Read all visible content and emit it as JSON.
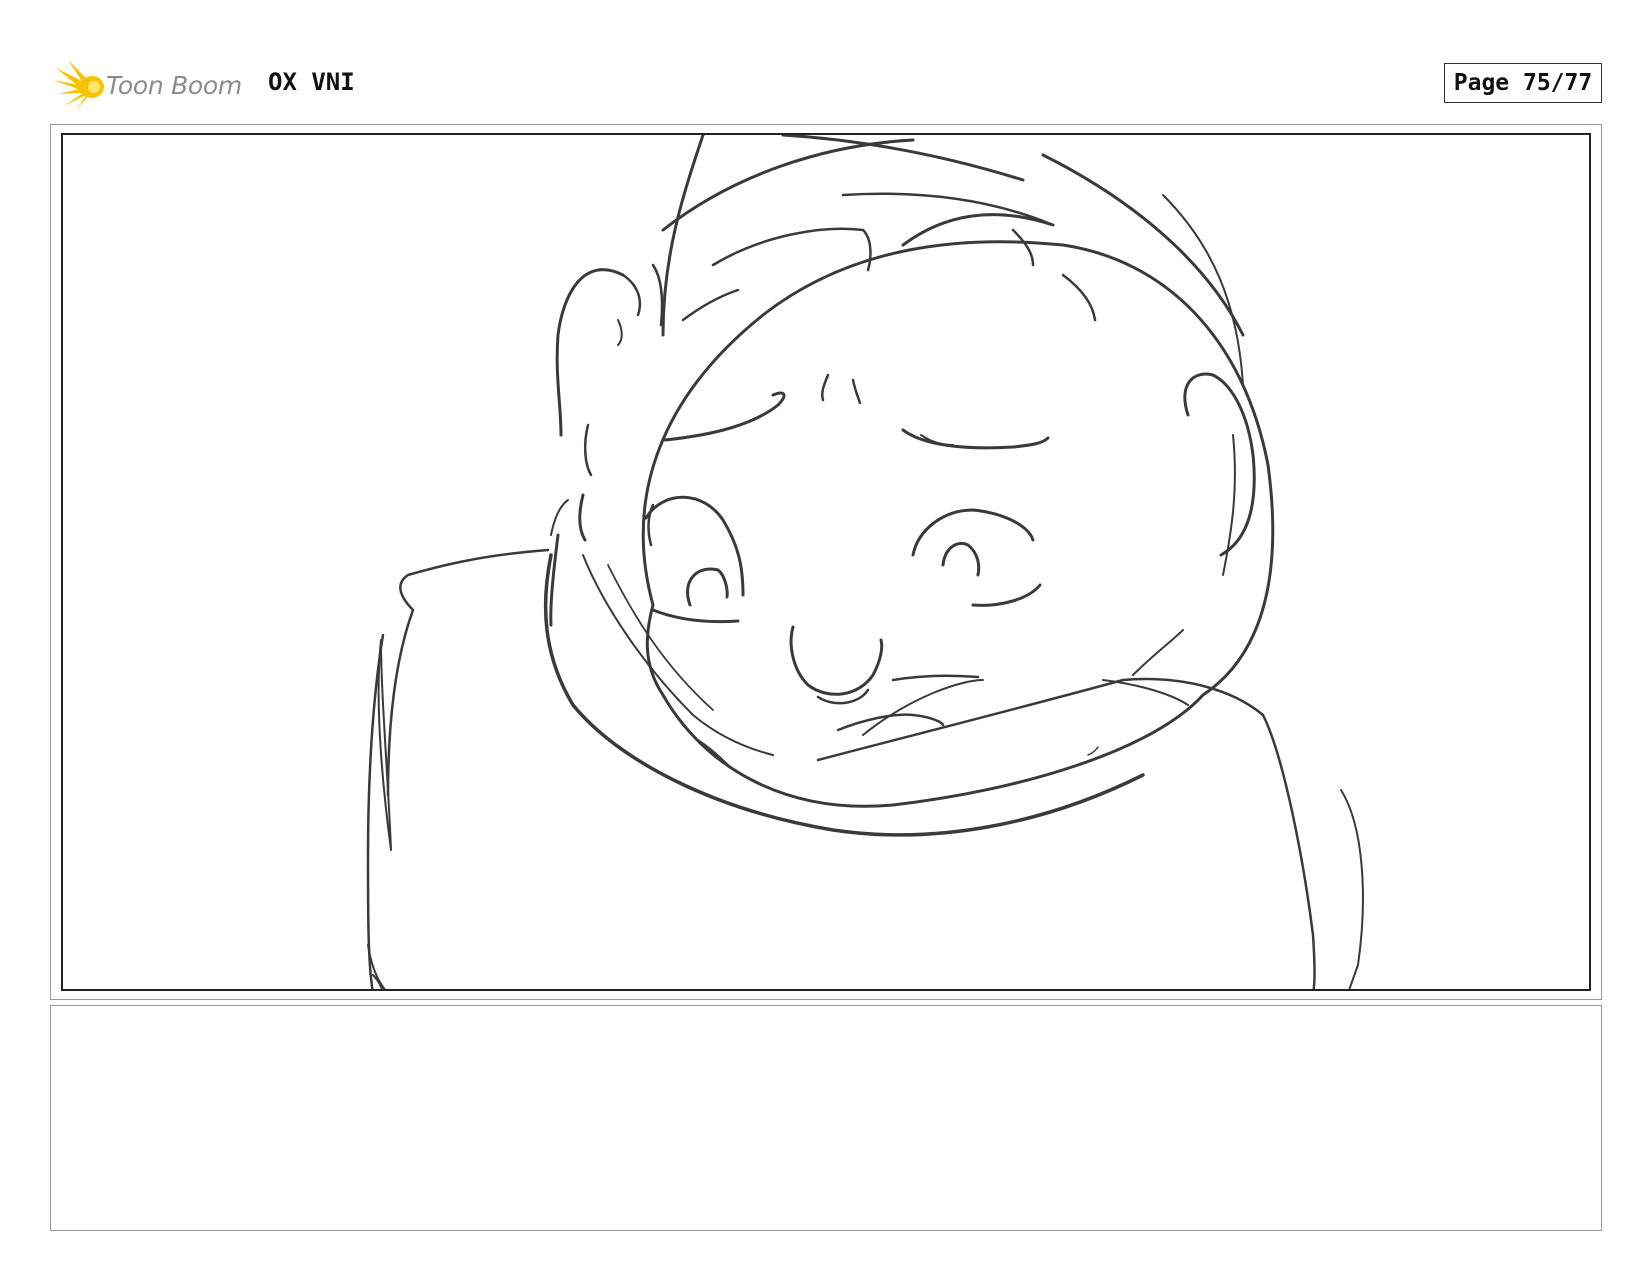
{
  "header": {
    "logo_text": "Toon Boom",
    "project_title": "OX VNI",
    "page_label": "Page 75/77"
  },
  "colors": {
    "logo_yellow": "#f5c400",
    "logo_text_gray": "#8c8c8c",
    "sketch_stroke": "#3a3a3a"
  },
  "panel": {
    "sketch_subject": "character-face-sketch"
  },
  "notes": {
    "text": ""
  }
}
